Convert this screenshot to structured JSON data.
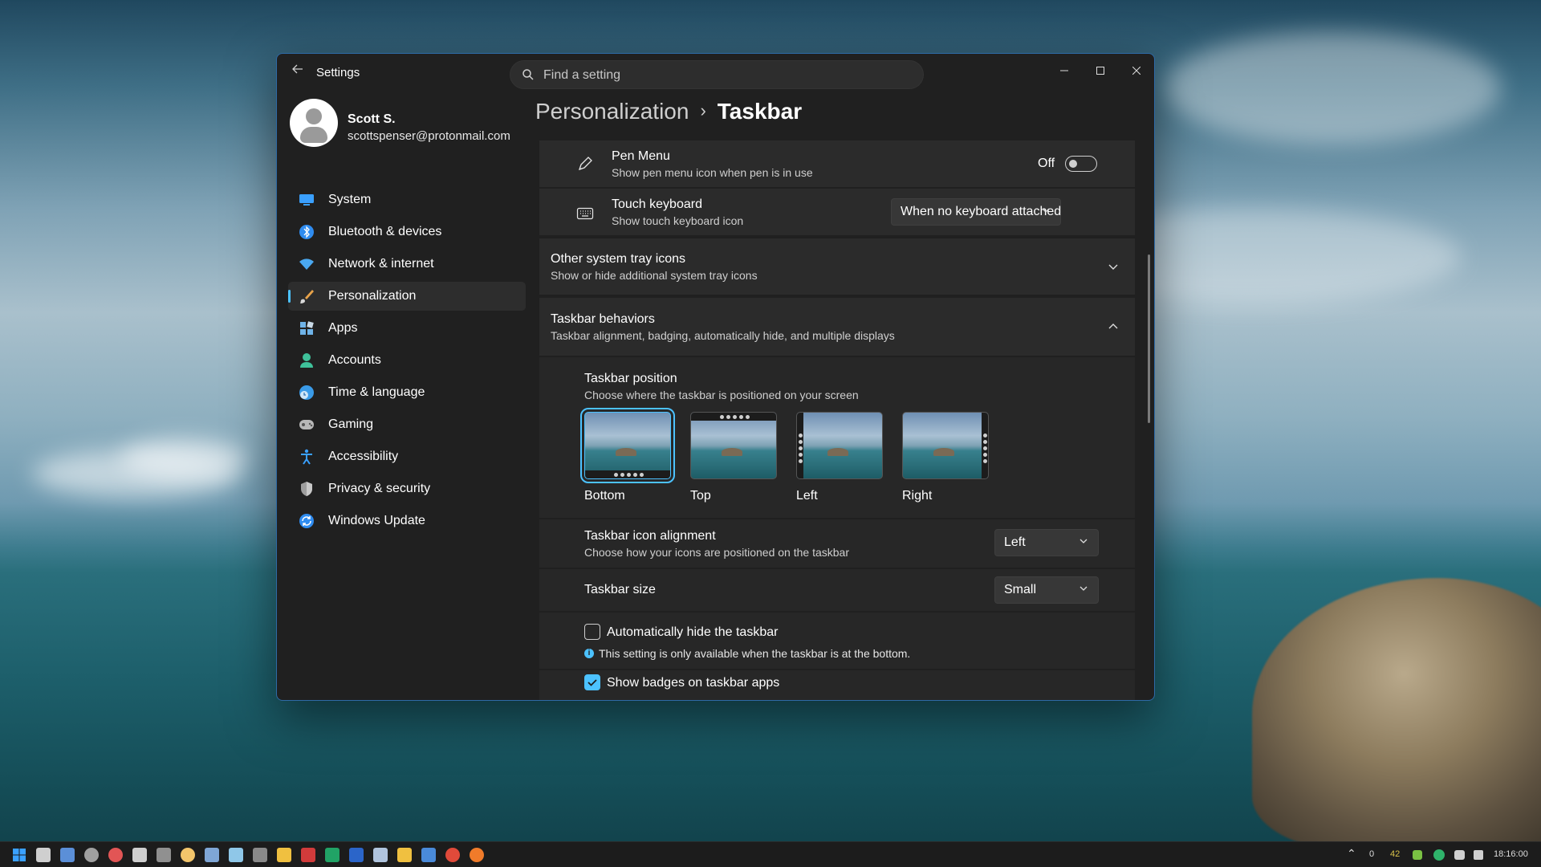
{
  "window": {
    "app_title": "Settings",
    "search_placeholder": "Find a setting"
  },
  "profile": {
    "name": "Scott S.",
    "email": "scottspenser@protonmail.com"
  },
  "sidebar": {
    "items": [
      {
        "label": "System",
        "icon": "system-icon"
      },
      {
        "label": "Bluetooth & devices",
        "icon": "bluetooth-icon"
      },
      {
        "label": "Network & internet",
        "icon": "wifi-icon"
      },
      {
        "label": "Personalization",
        "icon": "brush-icon",
        "active": true
      },
      {
        "label": "Apps",
        "icon": "apps-icon"
      },
      {
        "label": "Accounts",
        "icon": "person-icon"
      },
      {
        "label": "Time & language",
        "icon": "globe-clock-icon"
      },
      {
        "label": "Gaming",
        "icon": "gamepad-icon"
      },
      {
        "label": "Accessibility",
        "icon": "accessibility-icon"
      },
      {
        "label": "Privacy & security",
        "icon": "shield-icon"
      },
      {
        "label": "Windows Update",
        "icon": "update-icon"
      }
    ]
  },
  "breadcrumb": {
    "parent": "Personalization",
    "separator": "›",
    "current": "Taskbar"
  },
  "pen_menu": {
    "title": "Pen Menu",
    "subtitle": "Show pen menu icon when pen is in use",
    "state_label": "Off",
    "enabled": false
  },
  "touch_keyboard": {
    "title": "Touch keyboard",
    "subtitle": "Show touch keyboard icon",
    "value": "When no keyboard attached"
  },
  "other_tray": {
    "title": "Other system tray icons",
    "subtitle": "Show or hide additional system tray icons",
    "expanded": false
  },
  "behaviors": {
    "title": "Taskbar behaviors",
    "subtitle": "Taskbar alignment, badging, automatically hide, and multiple displays",
    "expanded": true
  },
  "position": {
    "title": "Taskbar position",
    "subtitle": "Choose where the taskbar is positioned on your screen",
    "options": [
      "Bottom",
      "Top",
      "Left",
      "Right"
    ],
    "selected": "Bottom"
  },
  "alignment": {
    "title": "Taskbar icon alignment",
    "subtitle": "Choose how your icons are positioned on the taskbar",
    "value": "Left"
  },
  "size": {
    "title": "Taskbar size",
    "value": "Small"
  },
  "auto_hide": {
    "label": "Automatically hide the taskbar",
    "checked": false,
    "info": "This setting is only available when the taskbar is at the bottom."
  },
  "badges": {
    "label": "Show badges on taskbar apps",
    "checked": true
  },
  "taskbar": {
    "tray_counts": [
      "0",
      "42"
    ],
    "clock": "18:16:00"
  },
  "colors": {
    "accent": "#4cc2ff",
    "window_bg": "#202020",
    "card_bg": "#2b2b2b"
  }
}
